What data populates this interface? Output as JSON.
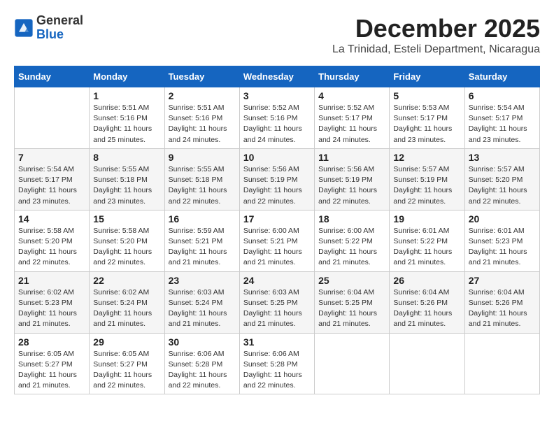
{
  "logo": {
    "line1": "General",
    "line2": "Blue"
  },
  "title": "December 2025",
  "location": "La Trinidad, Esteli Department, Nicaragua",
  "calendar": {
    "headers": [
      "Sunday",
      "Monday",
      "Tuesday",
      "Wednesday",
      "Thursday",
      "Friday",
      "Saturday"
    ],
    "weeks": [
      [
        {
          "day": "",
          "info": ""
        },
        {
          "day": "1",
          "info": "Sunrise: 5:51 AM\nSunset: 5:16 PM\nDaylight: 11 hours\nand 25 minutes."
        },
        {
          "day": "2",
          "info": "Sunrise: 5:51 AM\nSunset: 5:16 PM\nDaylight: 11 hours\nand 24 minutes."
        },
        {
          "day": "3",
          "info": "Sunrise: 5:52 AM\nSunset: 5:16 PM\nDaylight: 11 hours\nand 24 minutes."
        },
        {
          "day": "4",
          "info": "Sunrise: 5:52 AM\nSunset: 5:17 PM\nDaylight: 11 hours\nand 24 minutes."
        },
        {
          "day": "5",
          "info": "Sunrise: 5:53 AM\nSunset: 5:17 PM\nDaylight: 11 hours\nand 23 minutes."
        },
        {
          "day": "6",
          "info": "Sunrise: 5:54 AM\nSunset: 5:17 PM\nDaylight: 11 hours\nand 23 minutes."
        }
      ],
      [
        {
          "day": "7",
          "info": "Sunrise: 5:54 AM\nSunset: 5:17 PM\nDaylight: 11 hours\nand 23 minutes."
        },
        {
          "day": "8",
          "info": "Sunrise: 5:55 AM\nSunset: 5:18 PM\nDaylight: 11 hours\nand 23 minutes."
        },
        {
          "day": "9",
          "info": "Sunrise: 5:55 AM\nSunset: 5:18 PM\nDaylight: 11 hours\nand 22 minutes."
        },
        {
          "day": "10",
          "info": "Sunrise: 5:56 AM\nSunset: 5:19 PM\nDaylight: 11 hours\nand 22 minutes."
        },
        {
          "day": "11",
          "info": "Sunrise: 5:56 AM\nSunset: 5:19 PM\nDaylight: 11 hours\nand 22 minutes."
        },
        {
          "day": "12",
          "info": "Sunrise: 5:57 AM\nSunset: 5:19 PM\nDaylight: 11 hours\nand 22 minutes."
        },
        {
          "day": "13",
          "info": "Sunrise: 5:57 AM\nSunset: 5:20 PM\nDaylight: 11 hours\nand 22 minutes."
        }
      ],
      [
        {
          "day": "14",
          "info": "Sunrise: 5:58 AM\nSunset: 5:20 PM\nDaylight: 11 hours\nand 22 minutes."
        },
        {
          "day": "15",
          "info": "Sunrise: 5:58 AM\nSunset: 5:20 PM\nDaylight: 11 hours\nand 22 minutes."
        },
        {
          "day": "16",
          "info": "Sunrise: 5:59 AM\nSunset: 5:21 PM\nDaylight: 11 hours\nand 21 minutes."
        },
        {
          "day": "17",
          "info": "Sunrise: 6:00 AM\nSunset: 5:21 PM\nDaylight: 11 hours\nand 21 minutes."
        },
        {
          "day": "18",
          "info": "Sunrise: 6:00 AM\nSunset: 5:22 PM\nDaylight: 11 hours\nand 21 minutes."
        },
        {
          "day": "19",
          "info": "Sunrise: 6:01 AM\nSunset: 5:22 PM\nDaylight: 11 hours\nand 21 minutes."
        },
        {
          "day": "20",
          "info": "Sunrise: 6:01 AM\nSunset: 5:23 PM\nDaylight: 11 hours\nand 21 minutes."
        }
      ],
      [
        {
          "day": "21",
          "info": "Sunrise: 6:02 AM\nSunset: 5:23 PM\nDaylight: 11 hours\nand 21 minutes."
        },
        {
          "day": "22",
          "info": "Sunrise: 6:02 AM\nSunset: 5:24 PM\nDaylight: 11 hours\nand 21 minutes."
        },
        {
          "day": "23",
          "info": "Sunrise: 6:03 AM\nSunset: 5:24 PM\nDaylight: 11 hours\nand 21 minutes."
        },
        {
          "day": "24",
          "info": "Sunrise: 6:03 AM\nSunset: 5:25 PM\nDaylight: 11 hours\nand 21 minutes."
        },
        {
          "day": "25",
          "info": "Sunrise: 6:04 AM\nSunset: 5:25 PM\nDaylight: 11 hours\nand 21 minutes."
        },
        {
          "day": "26",
          "info": "Sunrise: 6:04 AM\nSunset: 5:26 PM\nDaylight: 11 hours\nand 21 minutes."
        },
        {
          "day": "27",
          "info": "Sunrise: 6:04 AM\nSunset: 5:26 PM\nDaylight: 11 hours\nand 21 minutes."
        }
      ],
      [
        {
          "day": "28",
          "info": "Sunrise: 6:05 AM\nSunset: 5:27 PM\nDaylight: 11 hours\nand 21 minutes."
        },
        {
          "day": "29",
          "info": "Sunrise: 6:05 AM\nSunset: 5:27 PM\nDaylight: 11 hours\nand 22 minutes."
        },
        {
          "day": "30",
          "info": "Sunrise: 6:06 AM\nSunset: 5:28 PM\nDaylight: 11 hours\nand 22 minutes."
        },
        {
          "day": "31",
          "info": "Sunrise: 6:06 AM\nSunset: 5:28 PM\nDaylight: 11 hours\nand 22 minutes."
        },
        {
          "day": "",
          "info": ""
        },
        {
          "day": "",
          "info": ""
        },
        {
          "day": "",
          "info": ""
        }
      ]
    ]
  }
}
